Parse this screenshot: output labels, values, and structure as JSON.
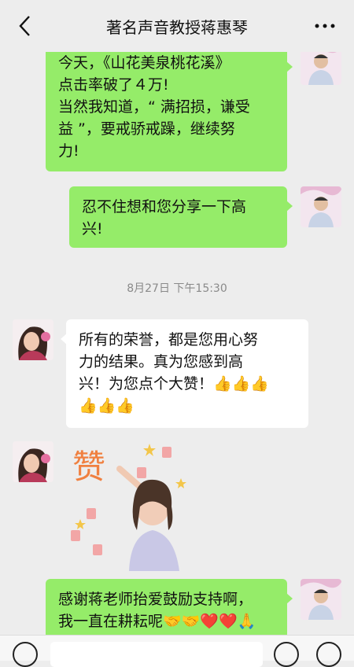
{
  "header": {
    "title": "著名声音教授蒋惠琴"
  },
  "messages": [
    {
      "side": "right",
      "text": "今天，《山花美泉桃花溪》\n点击率破了４万!\n当然我知道，“ 满招损，谦受\n益 ”，要戒骄戒躁，继续努\n力!"
    },
    {
      "side": "right",
      "text": "忍不住想和您分享一下高\n兴!"
    },
    {
      "side": "left",
      "text": "所有的荣誉，都是您用心努\n力的结果。真为您感到高\n兴！为您点个大赞！👍👍👍\n👍👍👍"
    },
    {
      "side": "right",
      "text": "感谢蒋老师抬爱鼓励支持啊，\n我一直在耕耘呢🤝🤝❤️❤️🙏"
    }
  ],
  "timestamp": "8月27日 下午15:30",
  "sticker": {
    "glyph": "赞"
  },
  "colors": {
    "bubble_green": "#95ec69",
    "bubble_white": "#ffffff",
    "background": "#ededed"
  },
  "icons": {
    "back": "chevron-left-icon",
    "more": "more-dots-icon",
    "voice": "voice-icon",
    "emoji": "emoji-icon",
    "plus": "plus-icon"
  }
}
